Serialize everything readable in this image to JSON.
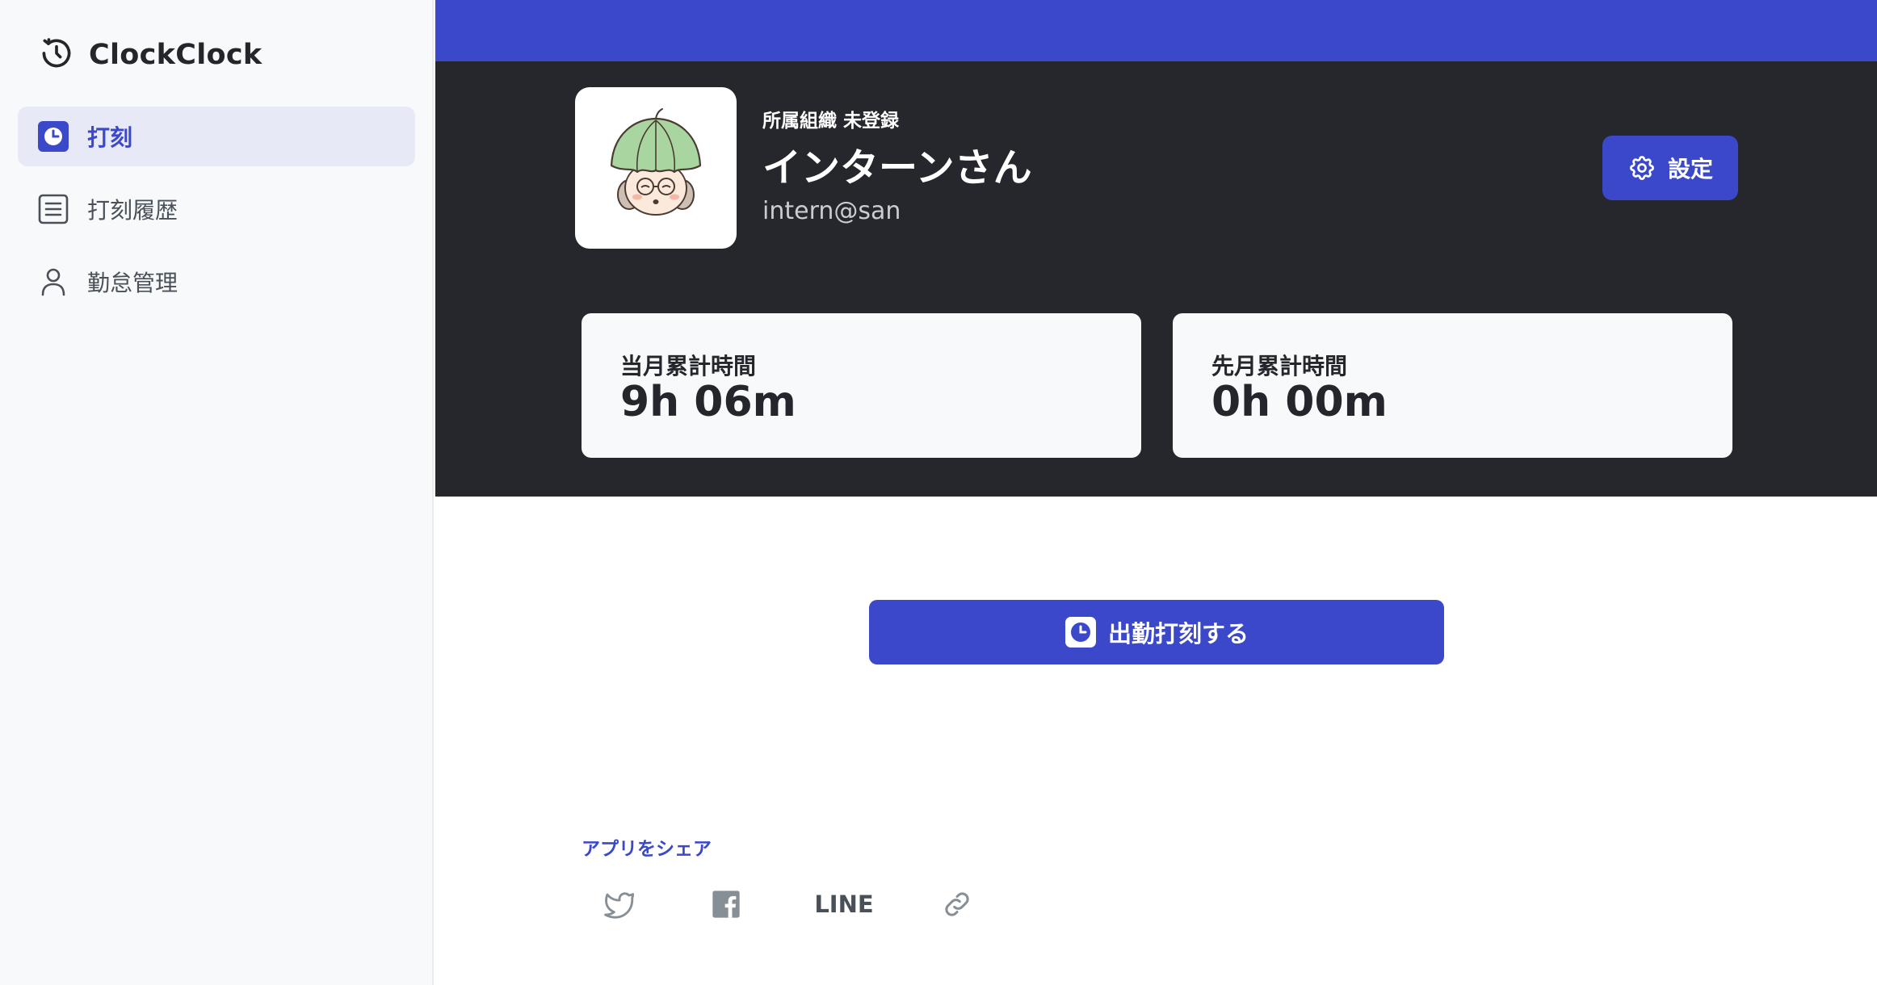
{
  "app": {
    "name": "ClockClock",
    "logo_icon": "clock-icon"
  },
  "sidebar": {
    "items": [
      {
        "label": "打刻",
        "icon": "clock-square-icon",
        "active": true
      },
      {
        "label": "打刻履歴",
        "icon": "list-icon",
        "active": false
      },
      {
        "label": "勤怠管理",
        "icon": "user-icon",
        "active": false
      }
    ]
  },
  "profile": {
    "org": "所属組織 未登録",
    "name": "インターンさん",
    "email": "intern@san",
    "avatar": "avatar-illustration"
  },
  "settings": {
    "label": "設定",
    "icon": "gear-icon"
  },
  "stats": [
    {
      "label": "当月累計時間",
      "value": "9h 06m"
    },
    {
      "label": "先月累計時間",
      "value": "0h 00m"
    }
  ],
  "clock_in": {
    "label": "出勤打刻する",
    "icon": "clock-square-icon"
  },
  "share": {
    "title": "アプリをシェア",
    "items": [
      {
        "icon": "twitter-icon"
      },
      {
        "icon": "facebook-icon"
      },
      {
        "label": "LINE"
      },
      {
        "icon": "link-icon"
      }
    ]
  },
  "colors": {
    "accent": "#3b48c9",
    "hero_bg": "#25272c",
    "sidebar_bg": "#f8f9fa",
    "card_bg": "#f8f9fa",
    "active_nav_bg": "#e8e9f7"
  }
}
